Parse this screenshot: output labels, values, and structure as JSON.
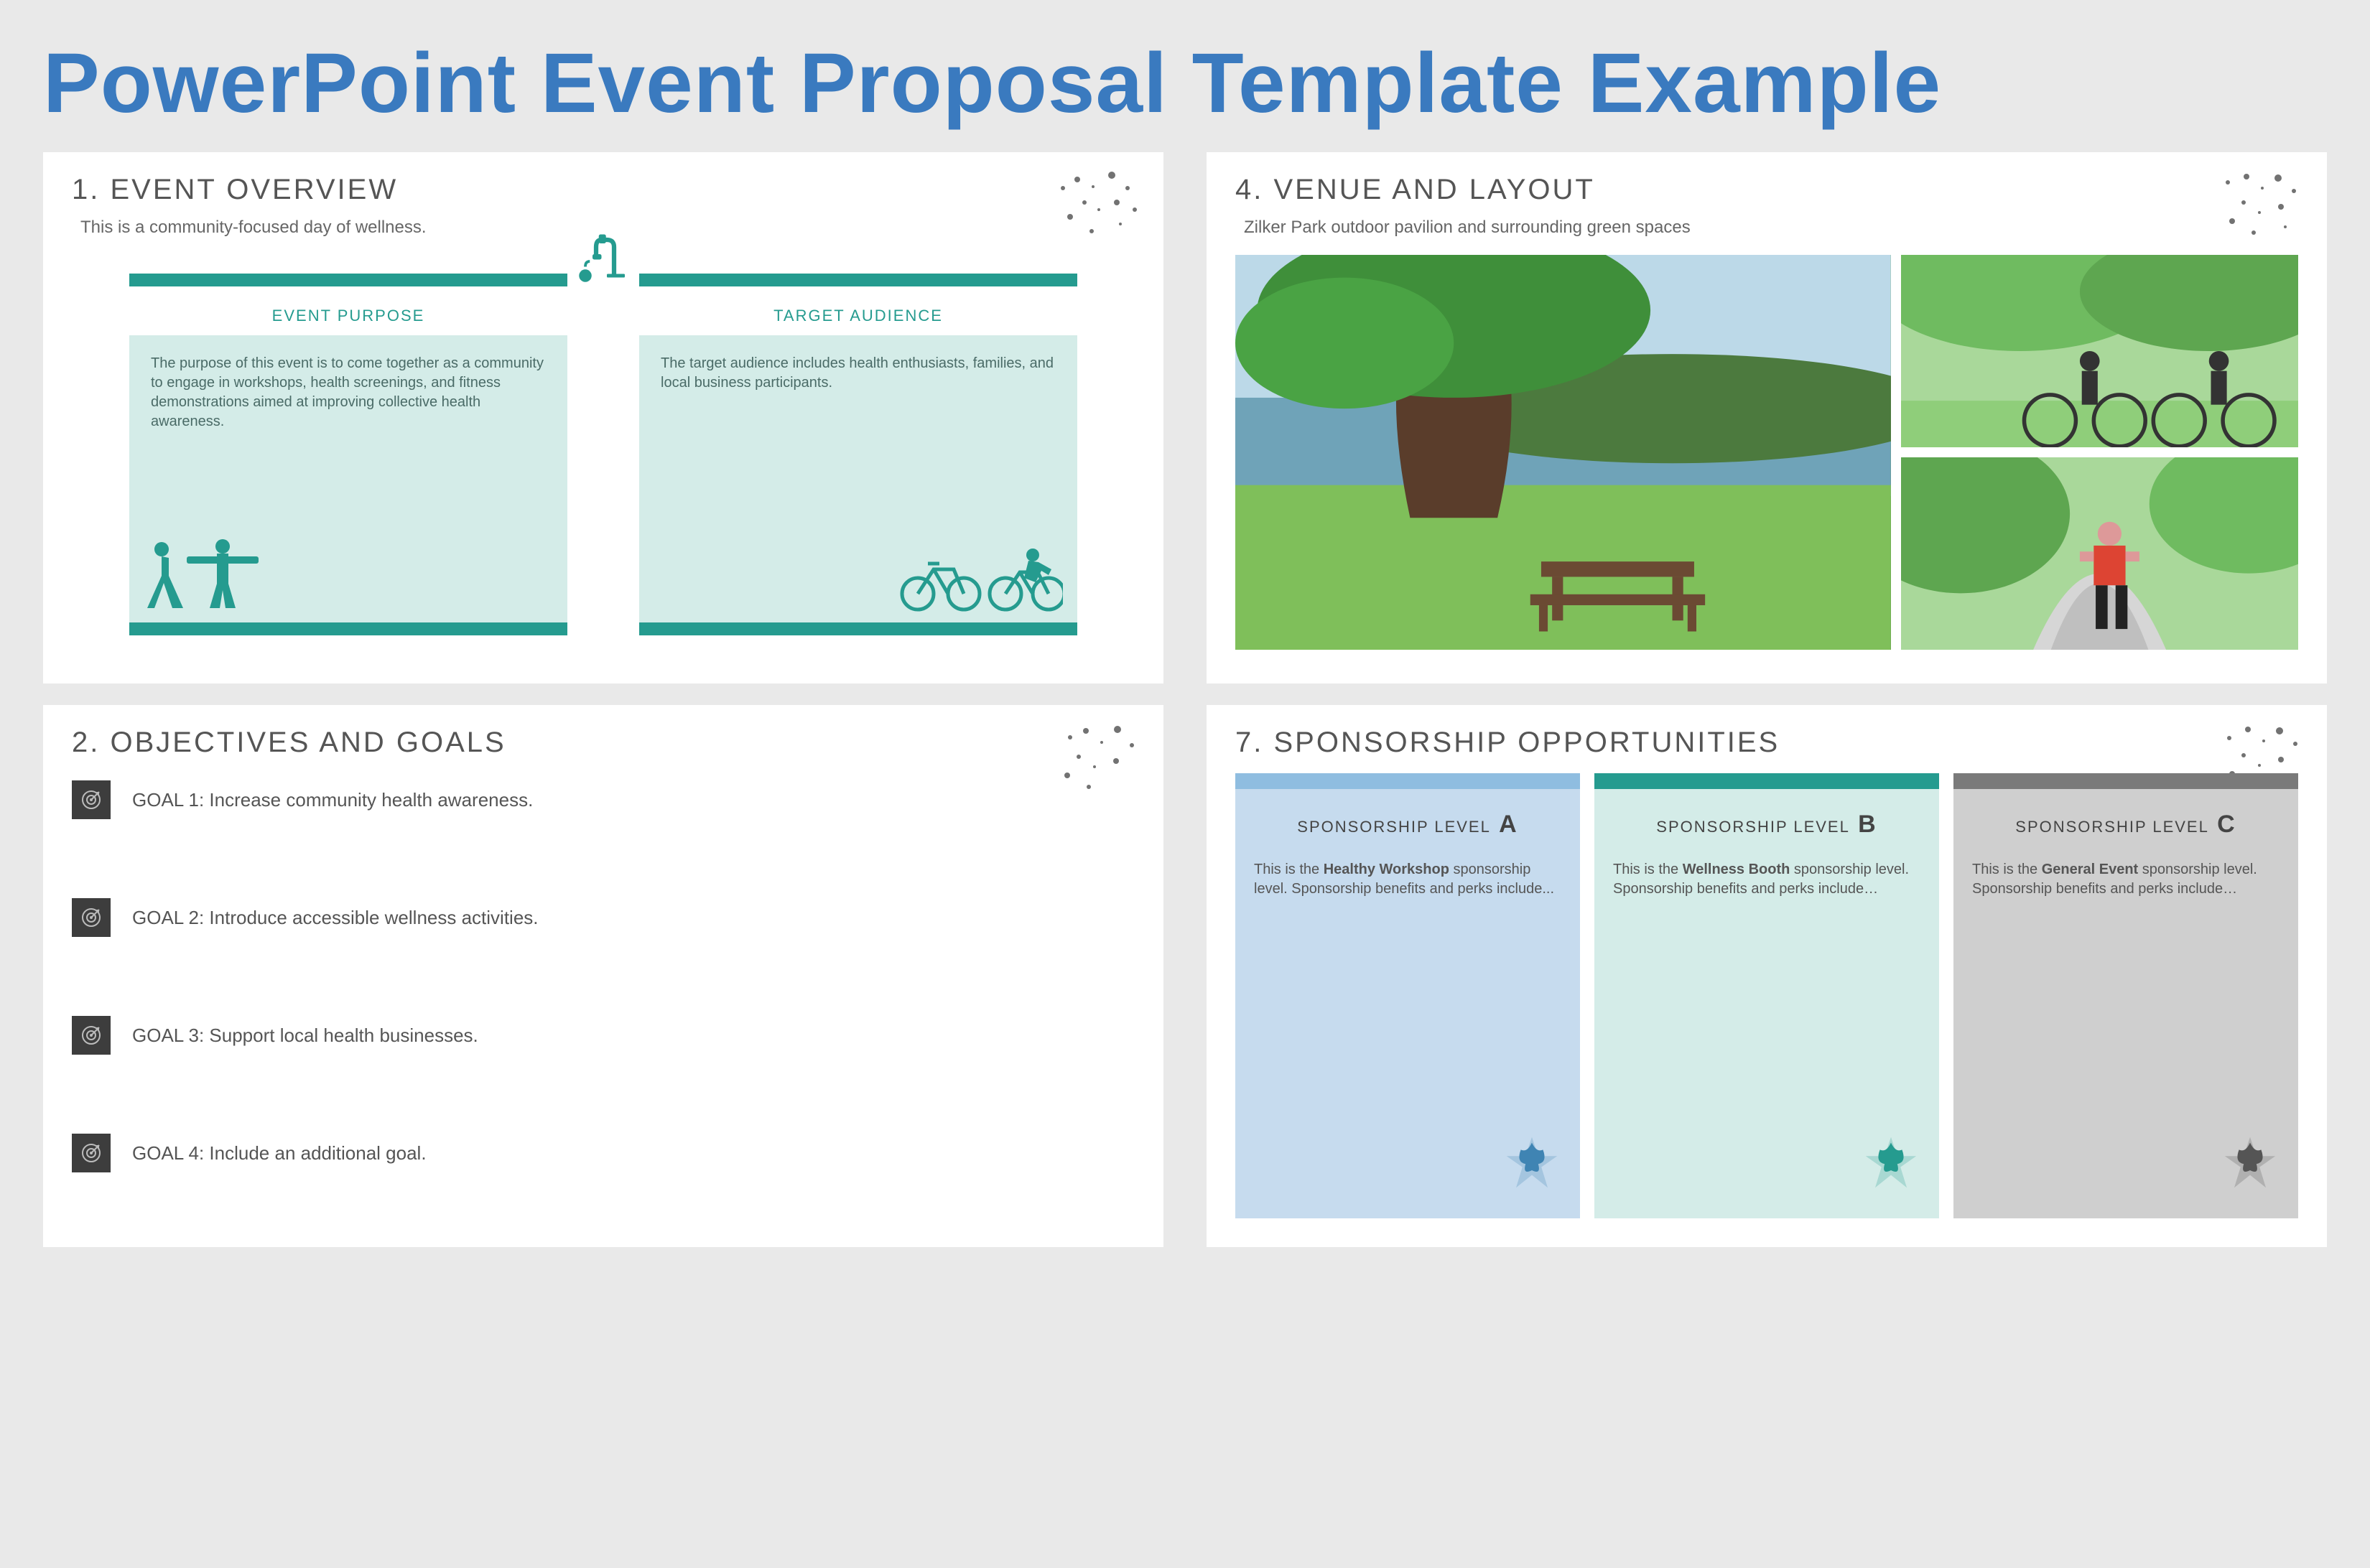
{
  "title": "PowerPoint Event Proposal Template Example",
  "slide1": {
    "heading": "1. EVENT OVERVIEW",
    "sub": "This is a community-focused day of wellness.",
    "col_left": {
      "label": "EVENT PURPOSE",
      "text": "The purpose of this event is to come together as a community to engage in workshops, health screenings, and fitness demonstrations aimed at improving collective health awareness."
    },
    "col_right": {
      "label": "TARGET AUDIENCE",
      "text": "The target audience includes health enthusiasts, families, and local business participants."
    }
  },
  "slide2": {
    "heading": "2. OBJECTIVES AND GOALS",
    "goals": [
      "GOAL 1: Increase community health awareness.",
      "GOAL 2: Introduce accessible wellness activities.",
      "GOAL 3: Support local health businesses.",
      "GOAL 4: Include an additional goal."
    ]
  },
  "slide4": {
    "heading": "4. VENUE AND LAYOUT",
    "sub": "Zilker Park outdoor pavilion and surrounding green spaces"
  },
  "slide7": {
    "heading": "7. SPONSORSHIP OPPORTUNITIES",
    "levels": {
      "a": {
        "title_prefix": "SPONSORSHIP LEVEL",
        "letter": "A",
        "desc_pre": "This is the ",
        "desc_bold": "Healthy Workshop",
        "desc_post": " sponsorship level. Sponsorship benefits and perks include..."
      },
      "b": {
        "title_prefix": "SPONSORSHIP LEVEL",
        "letter": "B",
        "desc_pre": "This is the ",
        "desc_bold": "Wellness Booth",
        "desc_post": " sponsorship level. Sponsorship benefits and perks include…"
      },
      "c": {
        "title_prefix": "SPONSORSHIP LEVEL",
        "letter": "C",
        "desc_pre": "This is the ",
        "desc_bold": "General Event",
        "desc_post": " sponsorship level. Sponsorship benefits and perks include…"
      }
    }
  },
  "colors": {
    "brand_blue": "#3a7abf",
    "brand_teal": "#259b8f"
  }
}
